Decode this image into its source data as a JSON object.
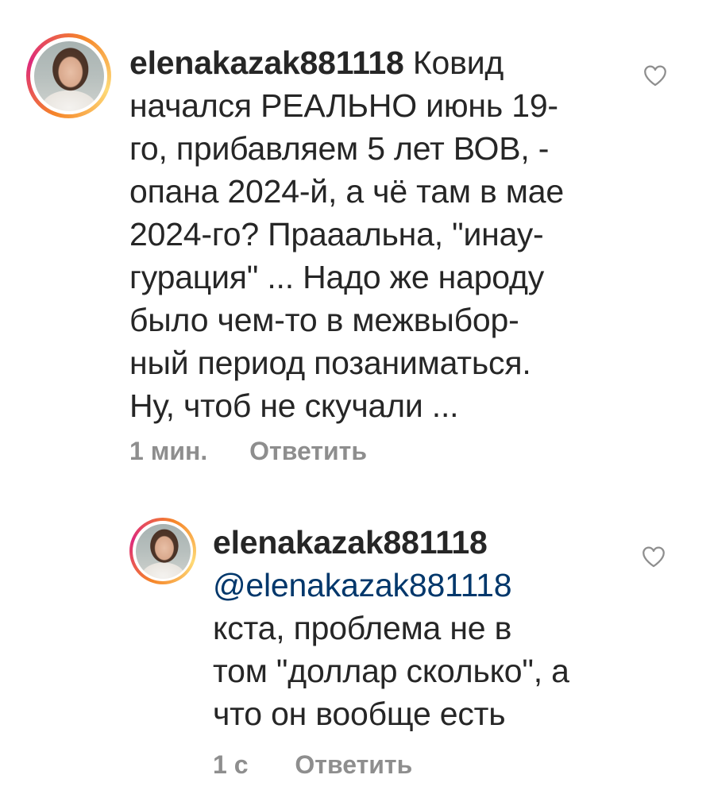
{
  "comments": [
    {
      "username": "elenakazak881118",
      "text_lines": [
        "Ковид",
        "начался РЕАЛЬНО июнь 19-",
        "го, прибавляем 5 лет ВОВ, -",
        "опана 2024-й, а чё там в мае",
        "2024-го? Прааальна, \"инау-",
        "гурация\" ... Надо же народу",
        "было чем-то в межвыбор-",
        "ный период позаниматься.",
        "Ну, чтоб не скучали ..."
      ],
      "time": "1 мин.",
      "reply_label": "Ответить",
      "like_icon": "heart-outline-icon"
    },
    {
      "username": "elenakazak881118",
      "mention": "@elenakazak881118",
      "text_lines": [
        "кста, проблема не в",
        "том \"доллар сколько\", а",
        "что он вообще есть"
      ],
      "time": "1 с",
      "reply_label": "Ответить",
      "like_icon": "heart-outline-icon"
    }
  ],
  "colors": {
    "text": "#262626",
    "meta": "#8e8e8e",
    "mention": "#00376b",
    "story_ring": "#dd2a7b"
  }
}
